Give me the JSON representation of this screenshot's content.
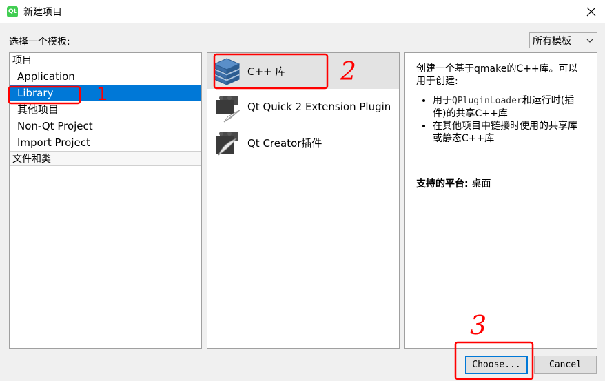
{
  "window": {
    "title": "新建项目",
    "app_icon_text": "Qt"
  },
  "header": {
    "choose_label": "选择一个模板:",
    "filter_value": "所有模板"
  },
  "categories": {
    "group1": "项目",
    "items": [
      "Application",
      "Library",
      "其他项目",
      "Non-Qt Project",
      "Import Project"
    ],
    "selected_index": 1,
    "group2": "文件和类"
  },
  "templates": {
    "items": [
      {
        "label": "C++ 库",
        "icon": "cpp-library-icon"
      },
      {
        "label": "Qt Quick 2 Extension Plugin",
        "icon": "qtquick-plugin-icon"
      },
      {
        "label": "Qt Creator插件",
        "icon": "qtcreator-plugin-icon"
      }
    ],
    "selected_index": 0
  },
  "description": {
    "intro": "创建一个基于qmake的C++库。可以用于创建:",
    "bullet1_pre": "用于",
    "bullet1_code": "QPluginLoader",
    "bullet1_post": "和运行时(插件)的共享C++库",
    "bullet2": "在其他项目中链接时使用的共享库或静态C++库",
    "platform_label": "支持的平台:",
    "platform_value": "桌面"
  },
  "buttons": {
    "choose": "Choose...",
    "cancel": "Cancel"
  },
  "annotations": {
    "mark1": "1",
    "mark2": "2",
    "mark3": "3",
    "color": "#ff0000"
  },
  "colors": {
    "selection": "#0078d7",
    "qt_green": "#41cd52"
  }
}
